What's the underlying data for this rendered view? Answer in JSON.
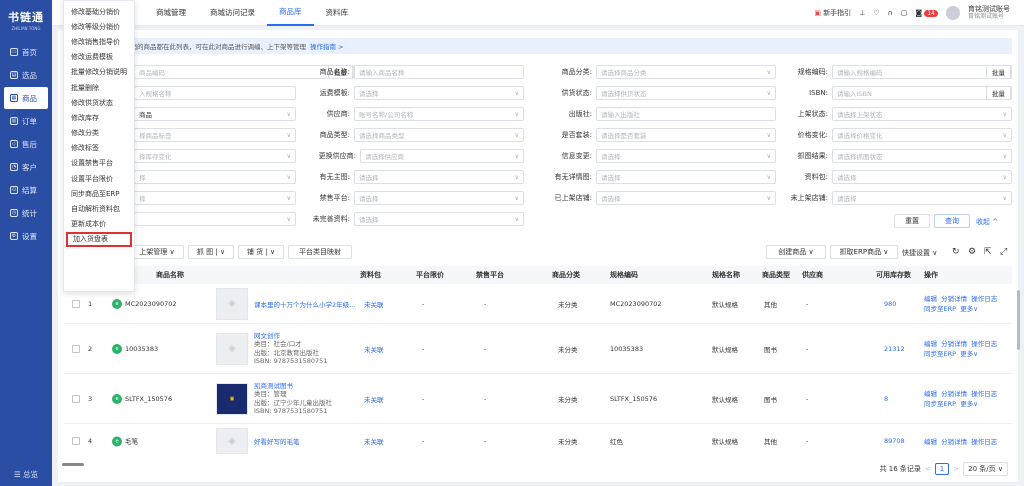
{
  "sidebar": {
    "logo_title": "书链通",
    "logo_sub": "ZHILIAN TONG",
    "items": [
      {
        "label": "首页"
      },
      {
        "label": "选品"
      },
      {
        "label": "商品"
      },
      {
        "label": "订单"
      },
      {
        "label": "售后"
      },
      {
        "label": "客户"
      },
      {
        "label": "结算"
      },
      {
        "label": "统计"
      },
      {
        "label": "设置"
      }
    ],
    "bottom": "总览"
  },
  "topbar": {
    "tabs": [
      {
        "label": "商城管理"
      },
      {
        "label": "商城访问记录"
      },
      {
        "label": "商品库"
      },
      {
        "label": "资料库"
      }
    ],
    "guide": "新手指引",
    "badge": "14",
    "account_name": "育铭测试账号",
    "account_sub": "育铭测试账号"
  },
  "dropdown": {
    "items": [
      "修改基础分销价",
      "修改等级分销价",
      "修改销售指导价",
      "修改运费模板",
      "批量修改分销说明",
      "批量删除",
      "修改供货状态",
      "修改库存",
      "修改分类",
      "修改标签",
      "设置禁售平台",
      "设置平台限价",
      "同步商品至ERP",
      "自动解析资料包",
      "更新成本价",
      "加入货盘表"
    ]
  },
  "notice": {
    "text": "分销的商品都在此列表，可在此对商品进行调编、上下架等管理",
    "link": "操作指南 >"
  },
  "filters": {
    "batch": "批量",
    "row1": [
      {
        "label": "",
        "placeholder": "商品编码"
      },
      {
        "label": "商品名称:",
        "placeholder": "请输入商品名称"
      },
      {
        "label": "商品分类:",
        "placeholder": "请选择商品分类"
      },
      {
        "label": "规格编码:",
        "placeholder": "请输入规格编码"
      }
    ],
    "row2": [
      {
        "label": "",
        "placeholder": "入规格名称"
      },
      {
        "label": "运费模板:",
        "placeholder": "请选择"
      },
      {
        "label": "供货状态:",
        "placeholder": "请选择供货状态"
      },
      {
        "label": "ISBN:",
        "placeholder": "请输入ISBN"
      }
    ],
    "row3": [
      {
        "label": "",
        "placeholder": "商品"
      },
      {
        "label": "供应商:",
        "placeholder": "账号名称/公司名称"
      },
      {
        "label": "出版社:",
        "placeholder": "请输入出版社"
      },
      {
        "label": "上架状态:",
        "placeholder": "请选择上架状态"
      }
    ],
    "row4": [
      {
        "label": "",
        "placeholder": "择商品标签"
      },
      {
        "label": "商品类型:",
        "placeholder": "请选择商品类型"
      },
      {
        "label": "是否套装:",
        "placeholder": "请选择是否套装"
      },
      {
        "label": "价格变化:",
        "placeholder": "请选择价格变化"
      }
    ],
    "row5": [
      {
        "label": "",
        "placeholder": "择库存变化"
      },
      {
        "label": "更换供应商:",
        "placeholder": "请选择供应商"
      },
      {
        "label": "信息变更:",
        "placeholder": "请选择"
      },
      {
        "label": "抓图结果:",
        "placeholder": "请选择抓图状态"
      }
    ],
    "row6": [
      {
        "label": "",
        "placeholder": "择"
      },
      {
        "label": "有无主图:",
        "placeholder": "请选择"
      },
      {
        "label": "有无详情图:",
        "placeholder": "请选择"
      },
      {
        "label": "资料包:",
        "placeholder": "请选择"
      }
    ],
    "row7": [
      {
        "label": "",
        "placeholder": "择"
      },
      {
        "label": "禁售平台:",
        "placeholder": "请选择"
      },
      {
        "label": "已上架店铺:",
        "placeholder": "请选择"
      },
      {
        "label": "未上架店铺:",
        "placeholder": "请选择"
      }
    ],
    "row8": [
      {
        "label": "",
        "placeholder": ""
      },
      {
        "label": "未完善资料:",
        "placeholder": "请选择"
      }
    ],
    "reset": "重置",
    "query": "查询",
    "collapse": "收起 ^"
  },
  "toolbar": {
    "b1": "上架管理",
    "b2": "抓 图",
    "b3": "铺 货",
    "b4": "平台类目映射",
    "create": "创建商品",
    "erp": "抓取ERP商品",
    "quick": "快捷设置"
  },
  "table": {
    "headers": [
      "商品名称",
      "资料包",
      "平台限价",
      "禁售平台",
      "商品分类",
      "规格编码",
      "规格名称",
      "商品类型",
      "供应商",
      "可用库存数",
      "操作"
    ],
    "rows": [
      {
        "idx": "1",
        "code": "MC2023090702",
        "name": "课本里的十万个为什么小学2年级...",
        "details": [],
        "pkg": "未关联",
        "limit": "-",
        "ban": "-",
        "cat": "未分类",
        "spec_code": "MC2023090702",
        "spec_name": "默认规格",
        "type": "其他",
        "supplier": "-",
        "stock": "980",
        "ops": [
          "编辑",
          "分销详情",
          "操作日志"
        ],
        "ops2": [
          "同步至ERP",
          "更多"
        ]
      },
      {
        "idx": "2",
        "code": "10035383",
        "name": "网文创作",
        "details": [
          "类目：社会/口才",
          "出版：北京教育出版社",
          "ISBN: 9787531580751"
        ],
        "pkg": "未关联",
        "limit": "-",
        "ban": "-",
        "cat": "未分类",
        "spec_code": "10035383",
        "spec_name": "默认规格",
        "type": "图书",
        "supplier": "-",
        "stock": "21312",
        "ops": [
          "编辑",
          "分销详情",
          "操作日志"
        ],
        "ops2": [
          "同步至ERP",
          "更多"
        ]
      },
      {
        "idx": "3",
        "code": "SLTFX_150576",
        "name": "凯商测试图书",
        "details": [
          "类目：管理",
          "出版：辽宁少年儿童出版社",
          "ISBN: 9787531580751"
        ],
        "pkg": "未关联",
        "limit": "-",
        "ban": "-",
        "cat": "未分类",
        "spec_code": "SLTFX_150576",
        "spec_name": "默认规格",
        "type": "图书",
        "supplier": "-",
        "stock": "8",
        "ops": [
          "编辑",
          "分销详情",
          "操作日志"
        ],
        "ops2": [
          "同步至ERP",
          "更多"
        ]
      },
      {
        "idx": "4",
        "code": "毛笔",
        "name": "好看好写的毛笔",
        "details": [],
        "pkg": "未关联",
        "limit": "-",
        "ban": "-",
        "cat": "未分类",
        "spec_code": "红色",
        "spec_name": "默认规格",
        "type": "其他",
        "supplier": "-",
        "stock": "89708",
        "ops": [
          "编辑",
          "分销详情",
          "操作日志"
        ],
        "ops2": []
      }
    ]
  },
  "pager": {
    "total": "共 16 条记录",
    "page": "1",
    "size": "20 条/页"
  }
}
